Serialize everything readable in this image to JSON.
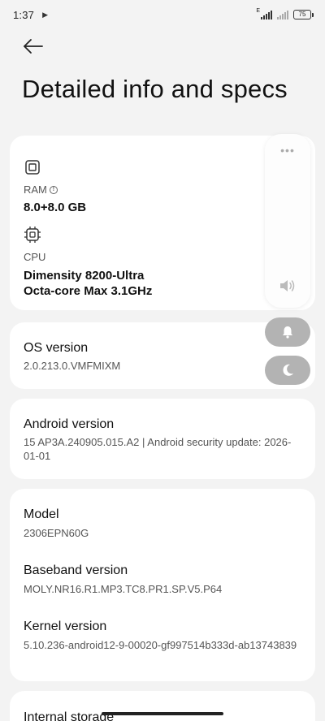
{
  "status_bar": {
    "time": "1:37",
    "battery": "75",
    "network_label": "E"
  },
  "header": {
    "title": "Detailed info and specs"
  },
  "hardware": {
    "ram_label": "RAM",
    "ram_value": "8.0+8.0 GB",
    "cpu_label": "CPU",
    "cpu_value_line1": "Dimensity 8200-Ultra",
    "cpu_value_line2": "Octa-core Max 3.1GHz"
  },
  "os": {
    "title": "OS version",
    "value": "2.0.213.0.VMFMIXM"
  },
  "android": {
    "title": "Android version",
    "value": "15 AP3A.240905.015.A2 | Android security update: 2026-01-01"
  },
  "device": {
    "model_title": "Model",
    "model_value": "2306EPN60G",
    "baseband_title": "Baseband version",
    "baseband_value": "MOLY.NR16.R1.MP3.TC8.PR1.SP.V5.P64",
    "kernel_title": "Kernel version",
    "kernel_value": "5.10.236-android12-9-00020-gf997514b333d-ab13743839"
  },
  "storage": {
    "title": "Internal storage"
  },
  "volume_panel": {
    "more_label": "•••",
    "level": 0
  }
}
